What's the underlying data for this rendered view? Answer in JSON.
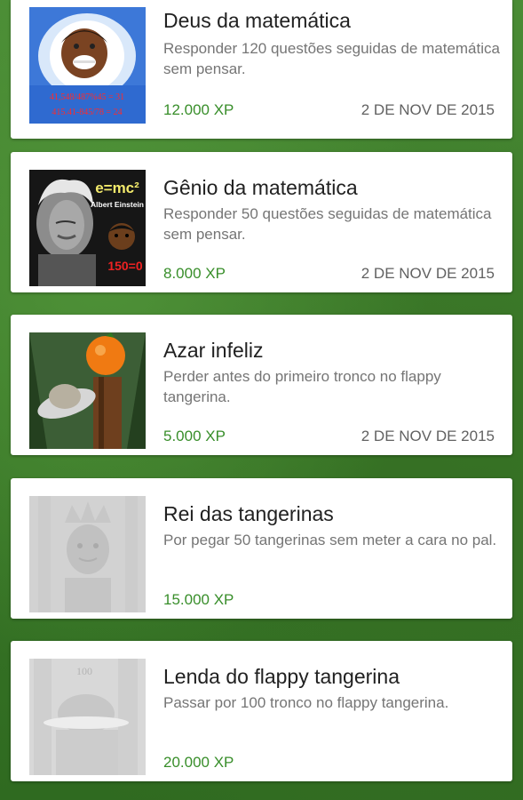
{
  "achievements": [
    {
      "title": "Deus da matemática",
      "description": "Responder 120 questões seguidas de matemática sem pensar.",
      "xp": "12.000 XP",
      "date": "2 DE NOV DE 2015",
      "image_text": [
        "41,548/487%45 = 31",
        "415.41-845/78 = 24"
      ],
      "icon": "math-god-icon"
    },
    {
      "title": "Gênio da matemática",
      "description": "Responder 50 questões seguidas de matemática sem pensar.",
      "xp": "8.000 XP",
      "date": "2 DE NOV DE 2015",
      "image_text": [
        "e=mc²",
        "Albert Einstein",
        "150=0"
      ],
      "icon": "einstein-icon"
    },
    {
      "title": "Azar infeliz",
      "description": "Perder antes do primeiro tronco no flappy tangerina.",
      "xp": "5.000 XP",
      "date": "2 DE NOV DE 2015",
      "icon": "tangerine-trunk-icon"
    },
    {
      "title": "Rei das tangerinas",
      "description": "Por pegar 50 tangerinas sem meter a cara no pal.",
      "xp": "15.000 XP",
      "date": "",
      "icon": "tangerine-king-icon"
    },
    {
      "title": "Lenda do flappy tangerina",
      "description": "Passar por 100 tronco no flappy tangerina.",
      "xp": "20.000 XP",
      "date": "",
      "image_text": [
        "100"
      ],
      "icon": "flappy-legend-icon"
    }
  ],
  "colors": {
    "xp_green": "#388e2a",
    "background_green": "#3f7f2a"
  }
}
